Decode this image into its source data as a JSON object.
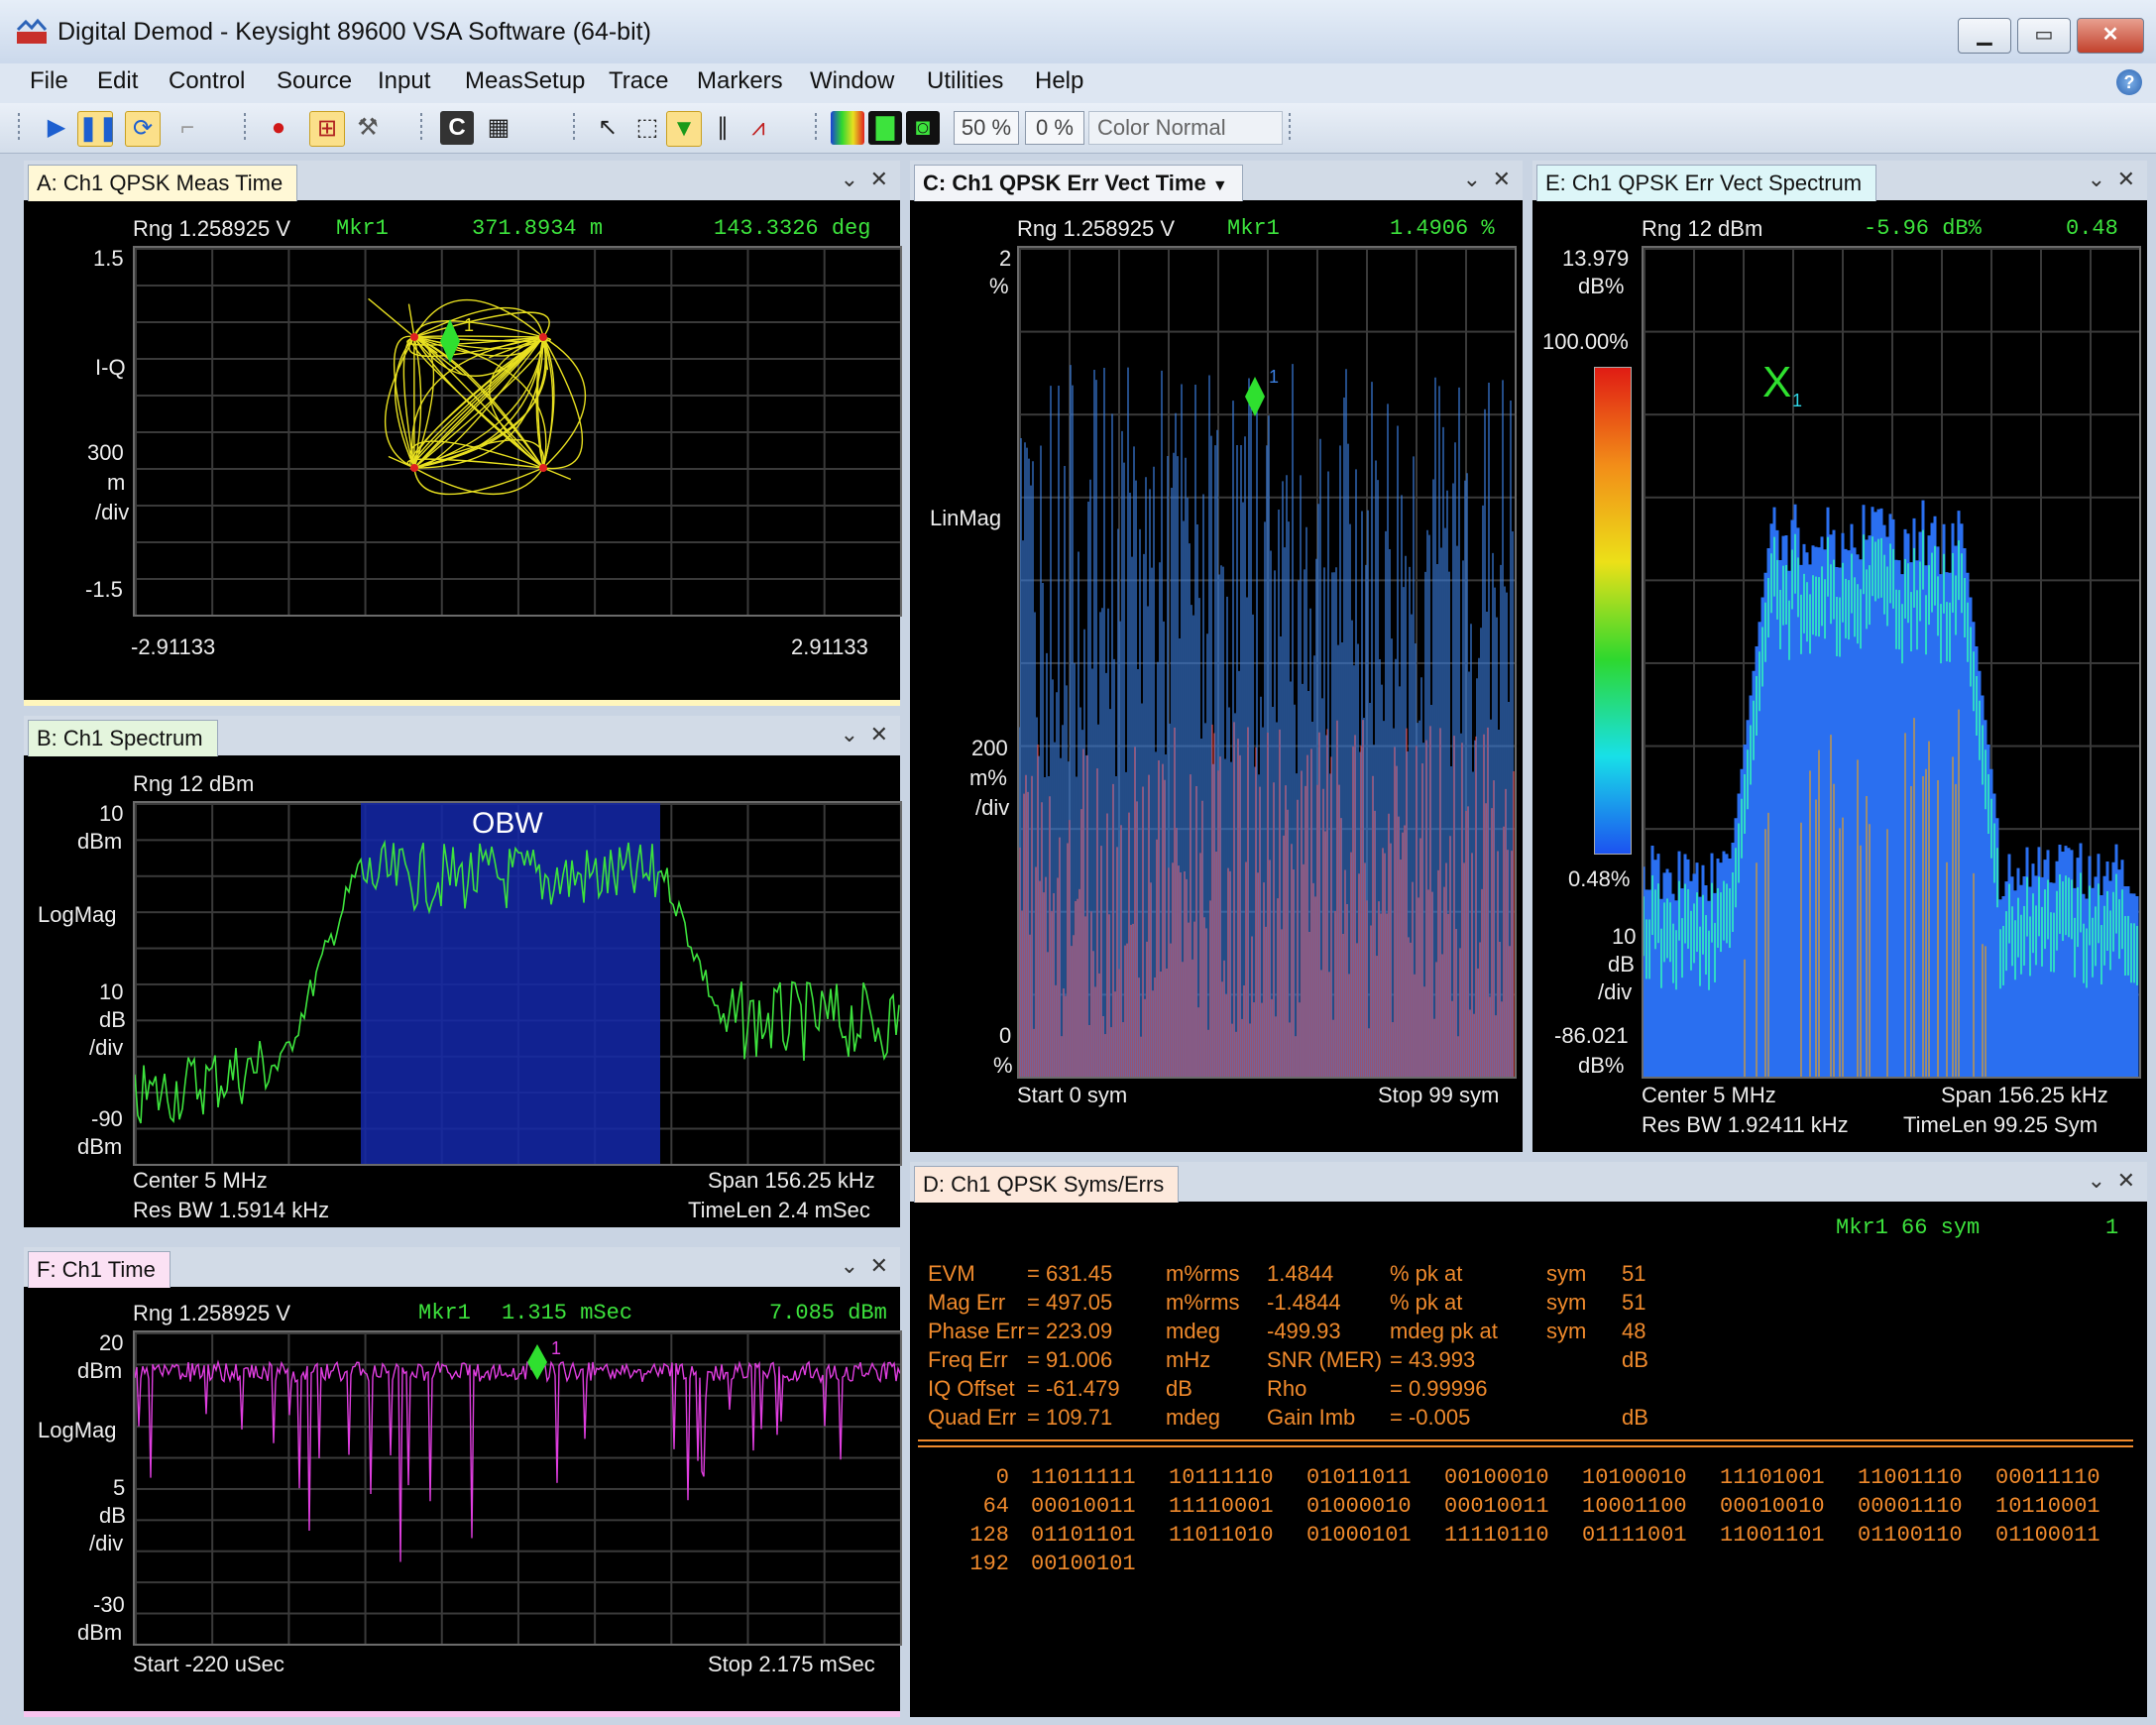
{
  "window": {
    "title": "Digital Demod - Keysight 89600 VSA Software (64-bit)",
    "controls": [
      "▁",
      "▭",
      "✕"
    ]
  },
  "menu": [
    "File",
    "Edit",
    "Control",
    "Source",
    "Input",
    "MeasSetup",
    "Trace",
    "Markers",
    "Window",
    "Utilities",
    "Help"
  ],
  "toolbar": {
    "persist1": "50 %",
    "persist2": "0 %",
    "color_mode": "Color Normal"
  },
  "panelA": {
    "tab": "A: Ch1 QPSK Meas Time",
    "rng": "Rng 1.258925  V",
    "mkr": "Mkr1",
    "mkr_x": "371.8934 m",
    "mkr_y": "143.3326  deg",
    "y_top": "1.5",
    "y_fmt": "I-Q",
    "y_div1": "300",
    "y_div2": "m",
    "y_div3": "/div",
    "y_bot": "-1.5",
    "x_left": "-2.91133",
    "x_right": "2.91133",
    "marker_label": "1"
  },
  "panelB": {
    "tab": "B: Ch1 Spectrum",
    "rng": "Rng 12 dBm",
    "y_top1": "10",
    "y_top2": "dBm",
    "y_fmt": "LogMag",
    "y_div1": "10",
    "y_div2": "dB",
    "y_div3": "/div",
    "y_bot1": "-90",
    "y_bot2": "dBm",
    "obw": "OBW",
    "center": "Center 5 MHz",
    "span": "Span 156.25 kHz",
    "resbw": "Res BW 1.5914 kHz",
    "timelen": "TimeLen 2.4 mSec"
  },
  "panelC": {
    "tab": "C: Ch1 QPSK Err Vect Time",
    "rng": "Rng 1.258925  V",
    "mkr": "Mkr1",
    "mkr_y": "1.4906   %",
    "y_top1": "2",
    "y_top2": "%",
    "y_fmt": "LinMag",
    "y_div1": "200",
    "y_div2": "m%",
    "y_div3": "/div",
    "y_bot1": "0",
    "y_bot2": "%",
    "start": "Start 0  sym",
    "stop": "Stop 99  sym",
    "marker_label": "1"
  },
  "panelE": {
    "tab": "E: Ch1 QPSK Err Vect Spectrum",
    "rng": "Rng 12 dBm",
    "mkr_y": "-5.96   dB%",
    "mkr_z": "0.48",
    "y_top1": "13.979",
    "y_top2": "dB%",
    "scale_top": "100.00%",
    "scale_bot": "0.48%",
    "y_div1": "10",
    "y_div2": "dB",
    "y_div3": "/div",
    "y_bot1": "-86.021",
    "y_bot2": "dB%",
    "center": "Center 5 MHz",
    "span": "Span 156.25 kHz",
    "resbw": "Res BW 1.92411 kHz",
    "timelen": "TimeLen 99.25  Sym",
    "marker_label": "1"
  },
  "panelF": {
    "tab": "F: Ch1 Time",
    "rng": "Rng 1.258925  V",
    "mkr": "Mkr1",
    "mkr_x": "1.315 mSec",
    "mkr_y": "7.085  dBm",
    "y_top1": "20",
    "y_top2": "dBm",
    "y_fmt": "LogMag",
    "y_div1": "5",
    "y_div2": "dB",
    "y_div3": "/div",
    "y_bot1": "-30",
    "y_bot2": "dBm",
    "start": "Start -220 uSec",
    "stop": "Stop 2.175 mSec",
    "marker_label": "1"
  },
  "panelD": {
    "tab": "D: Ch1 QPSK Syms/Errs",
    "mkr": "Mkr1   66  sym",
    "mkr_val": "1",
    "rows": [
      [
        "EVM",
        "=  631.45",
        "m%rms",
        "1.4844",
        "% pk  at",
        "sym",
        "51"
      ],
      [
        "Mag Err",
        "=  497.05",
        "m%rms",
        "-1.4844",
        "% pk  at",
        "sym",
        "51"
      ],
      [
        "Phase Err",
        "=  223.09",
        "mdeg",
        "-499.93",
        "mdeg pk  at",
        "sym",
        "48"
      ],
      [
        "Freq Err",
        "=  91.006",
        "mHz",
        "SNR (MER)",
        "=  43.993",
        "",
        "dB"
      ],
      [
        "IQ Offset",
        "=  -61.479",
        "dB",
        "Rho",
        "=  0.99996",
        "",
        ""
      ],
      [
        "Quad Err",
        "=  109.71",
        "mdeg",
        "Gain  Imb",
        "=  -0.005",
        "",
        "dB"
      ]
    ],
    "bits": [
      {
        "idx": "0",
        "vals": [
          "11011111",
          "10111110",
          "01011011",
          "00100010",
          "10100010",
          "11101001",
          "11001110",
          "00011110"
        ]
      },
      {
        "idx": "64",
        "vals": [
          "00010011",
          "11110001",
          "01000010",
          "00010011",
          "10001100",
          "00010010",
          "00001110",
          "10110001"
        ]
      },
      {
        "idx": "128",
        "vals": [
          "01101101",
          "11011010",
          "01000101",
          "11110110",
          "01111001",
          "11001101",
          "01100110",
          "01100011"
        ]
      },
      {
        "idx": "192",
        "vals": [
          "00100101"
        ]
      }
    ]
  },
  "colors": {
    "tabA": "#fff8d6",
    "tabB": "#e4f5dd",
    "tabC": "#f2f4f8",
    "tabD": "#fde9dc",
    "tabE": "#ddf6f8",
    "tabF": "#fbe1f4",
    "trace_iq": "#e8e020",
    "trace_spec": "#3de33d",
    "trace_time": "#e03ee0",
    "marker": "#2fe02f",
    "readout_green": "#3de33d",
    "table_orange": "#f08a2c"
  }
}
